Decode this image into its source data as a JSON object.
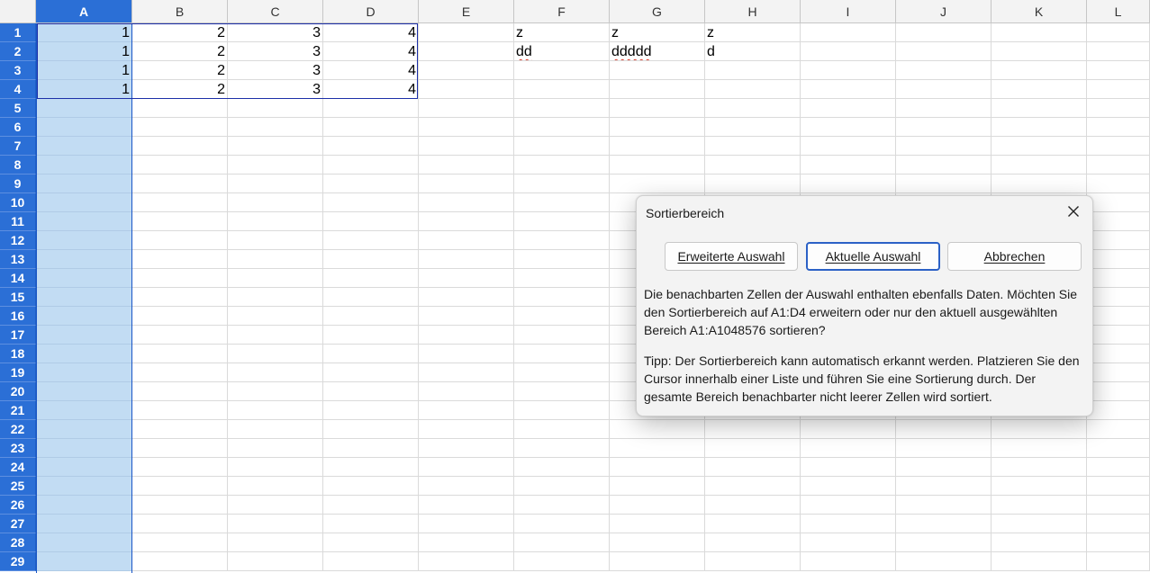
{
  "sheet": {
    "columns": [
      "A",
      "B",
      "C",
      "D",
      "E",
      "F",
      "G",
      "H",
      "I",
      "J",
      "K",
      "L"
    ],
    "selected_column": "A",
    "rows": [
      "1",
      "2",
      "3",
      "4",
      "5",
      "6",
      "7",
      "8",
      "9",
      "10",
      "11",
      "12",
      "13",
      "14",
      "15",
      "16",
      "17",
      "18",
      "19",
      "20",
      "21",
      "22",
      "23",
      "24",
      "25",
      "26",
      "27",
      "28",
      "29"
    ],
    "cells": [
      [
        "1",
        "2",
        "3",
        "4",
        "",
        "z",
        "z",
        "z",
        "",
        "",
        "",
        ""
      ],
      [
        "1",
        "2",
        "3",
        "4",
        "",
        "dd",
        "ddddd",
        "d",
        "",
        "",
        "",
        ""
      ],
      [
        "1",
        "2",
        "3",
        "4",
        "",
        "",
        "",
        "",
        "",
        "",
        "",
        ""
      ],
      [
        "1",
        "2",
        "3",
        "4",
        "",
        "",
        "",
        "",
        "",
        "",
        "",
        ""
      ]
    ],
    "spellcheck_cells": [
      "F2",
      "G2"
    ]
  },
  "dialog": {
    "title": "Sortierbereich",
    "buttons": {
      "extend": "Erweiterte Auswahl",
      "current": "Aktuelle Auswahl",
      "cancel": "Abbrechen"
    },
    "default_button": "current",
    "message": "Die benachbarten Zellen der Auswahl enthalten ebenfalls Daten. Möchten Sie den Sortierbereich auf A1:D4 erweitern oder nur den aktuell ausgewählten Bereich A1:A1048576 sortieren?",
    "tip": "Tipp: Der Sortierbereich kann automatisch erkannt werden. Platzieren Sie den Cursor innerhalb einer Liste und führen Sie eine Sortierung durch. Der gesamte Bereich benachbarter nicht leerer Zellen wird sortiert.",
    "close_icon": "close-icon"
  },
  "colors": {
    "header_selected": "#2b6fd6",
    "column_selection": "#c2dcf3",
    "range_outline": "#1c2fa8",
    "default_button_border": "#2b61c6"
  }
}
